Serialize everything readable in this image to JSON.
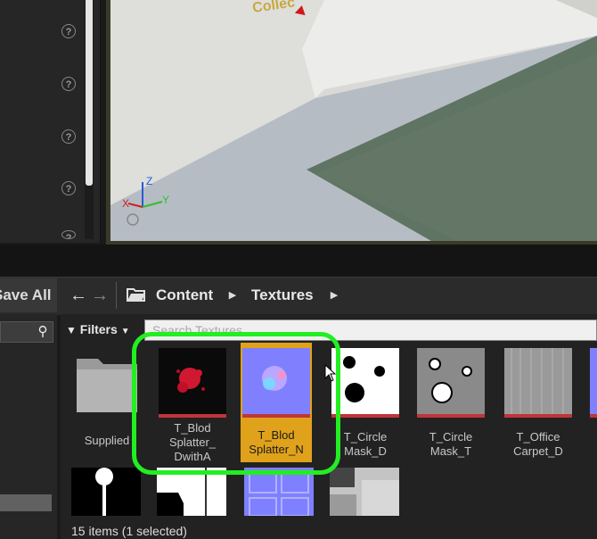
{
  "viewport": {
    "overlay_text": "Collec",
    "axes": {
      "x": "X",
      "y": "Y",
      "z": "Z"
    }
  },
  "details_panel": {
    "help_icons": [
      "?",
      "?",
      "?",
      "?",
      "?"
    ]
  },
  "toolbar": {
    "save_all_label": "Save All",
    "back_icon": "➔",
    "breadcrumbs": [
      "Content",
      "Textures"
    ]
  },
  "filters": {
    "label": "Filters",
    "search_placeholder": "Search Textures"
  },
  "assets": {
    "row1": [
      {
        "label": "Supplied",
        "kind": "folder",
        "selected": false
      },
      {
        "label": "T_Blod\nSplatter_\nDwithA",
        "kind": "blood",
        "selected": false
      },
      {
        "label": "T_Blod\nSplatter_N",
        "kind": "normal",
        "selected": true
      },
      {
        "label": "T_Circle\nMask_D",
        "kind": "mask_d",
        "selected": false
      },
      {
        "label": "T_Circle\nMask_T",
        "kind": "mask_t",
        "selected": false
      },
      {
        "label": "T_Office\nCarpet_D",
        "kind": "carpet",
        "selected": false
      }
    ],
    "row2_kinds": [
      "lamp",
      "white_mask",
      "normal_tiles",
      "grey_tiles"
    ]
  },
  "status": {
    "text": "15 items (1 selected)"
  },
  "colors": {
    "selection": "#e0a21a",
    "highlight": "#22ee22",
    "thumb_bar": "#c0353a"
  }
}
